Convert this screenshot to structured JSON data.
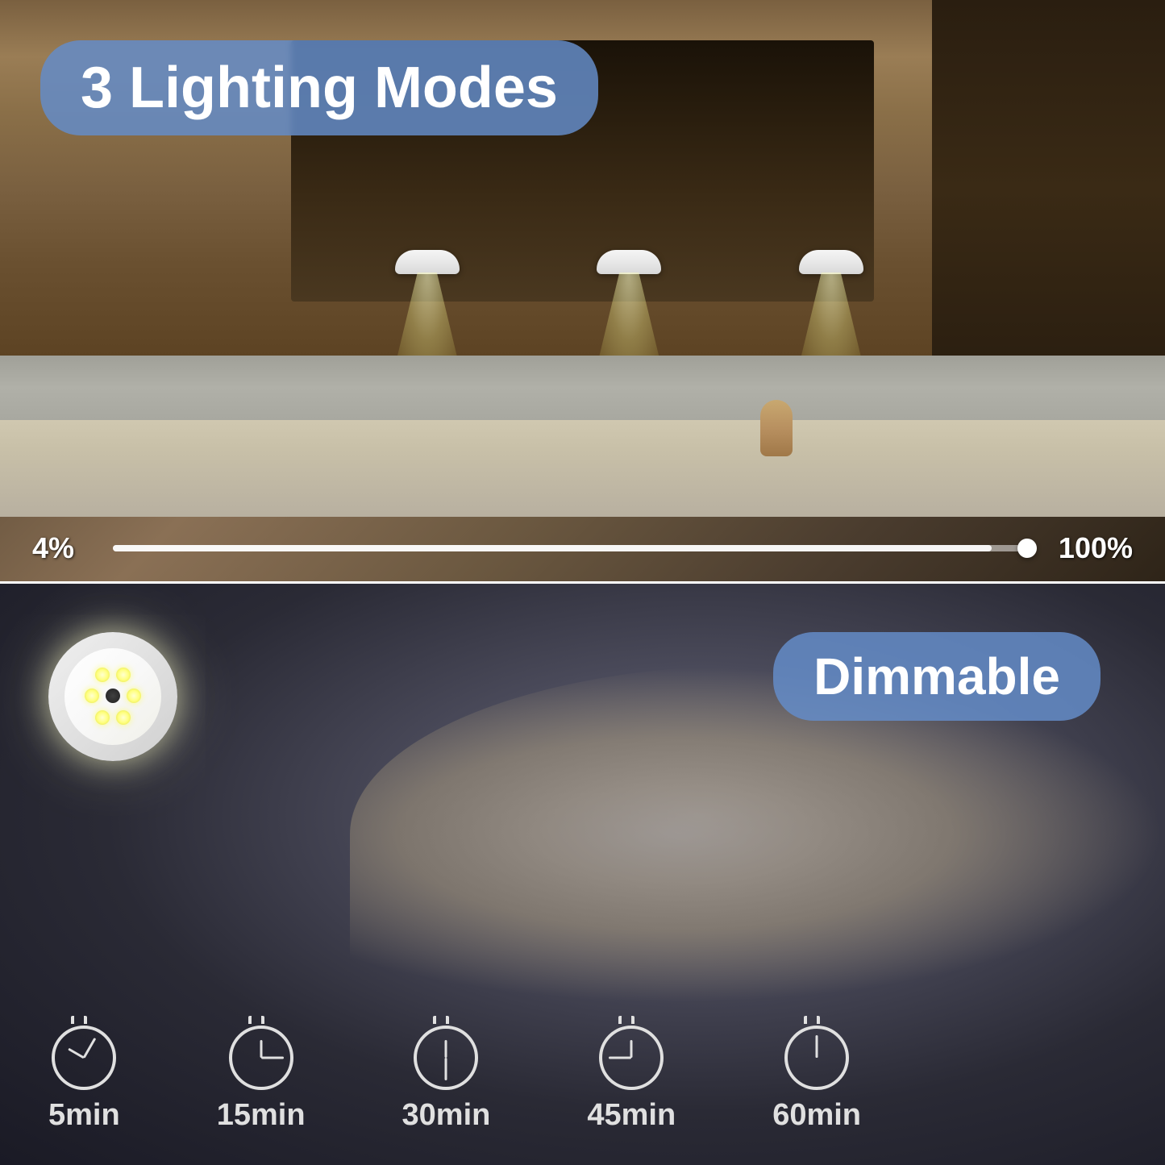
{
  "top": {
    "title": "3 Lighting Modes",
    "slider": {
      "min_label": "4%",
      "max_label": "100%"
    },
    "lights": [
      {
        "id": "light-1"
      },
      {
        "id": "light-2"
      },
      {
        "id": "light-3"
      }
    ]
  },
  "bottom": {
    "badge": "Dimmable",
    "timers": [
      {
        "label": "5min",
        "minutes": 5
      },
      {
        "label": "15min",
        "minutes": 15
      },
      {
        "label": "30min",
        "minutes": 30
      },
      {
        "label": "45min",
        "minutes": 45
      },
      {
        "label": "60min",
        "minutes": 60
      }
    ]
  },
  "colors": {
    "badge_bg": "rgba(100,140,200,0.85)",
    "text_white": "#ffffff",
    "timer_text": "#e0e0e0"
  }
}
